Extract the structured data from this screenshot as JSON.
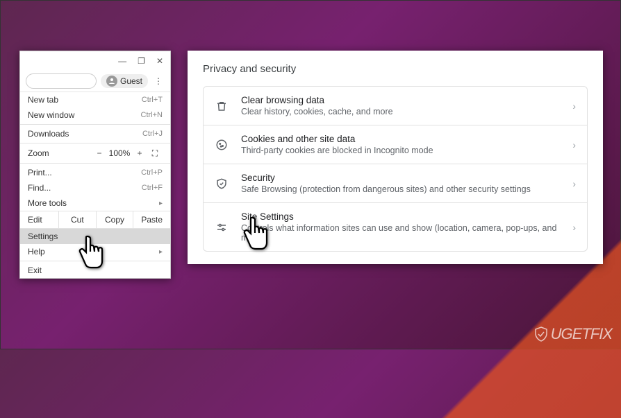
{
  "chrome_menu": {
    "guest_label": "Guest",
    "items": {
      "new_tab": {
        "label": "New tab",
        "shortcut": "Ctrl+T"
      },
      "new_window": {
        "label": "New window",
        "shortcut": "Ctrl+N"
      },
      "downloads": {
        "label": "Downloads",
        "shortcut": "Ctrl+J"
      },
      "zoom": {
        "label": "Zoom",
        "minus": "−",
        "value": "100%",
        "plus": "+",
        "full_icon": "⛶"
      },
      "print": {
        "label": "Print...",
        "shortcut": "Ctrl+P"
      },
      "find": {
        "label": "Find...",
        "shortcut": "Ctrl+F"
      },
      "more_tools": {
        "label": "More tools"
      },
      "edit": {
        "label": "Edit",
        "cut": "Cut",
        "copy": "Copy",
        "paste": "Paste"
      },
      "settings": {
        "label": "Settings"
      },
      "help": {
        "label": "Help"
      },
      "exit": {
        "label": "Exit"
      }
    }
  },
  "privacy": {
    "title": "Privacy and security",
    "rows": {
      "clear": {
        "title": "Clear browsing data",
        "sub": "Clear history, cookies, cache, and more"
      },
      "cookies": {
        "title": "Cookies and other site data",
        "sub": "Third-party cookies are blocked in Incognito mode"
      },
      "security": {
        "title": "Security",
        "sub": "Safe Browsing (protection from dangerous sites) and other security settings"
      },
      "site": {
        "title": "Site Settings",
        "sub": "Controls what information sites can use and show (location, camera, pop-ups, and more)"
      }
    }
  },
  "watermark": "UGETFIX"
}
